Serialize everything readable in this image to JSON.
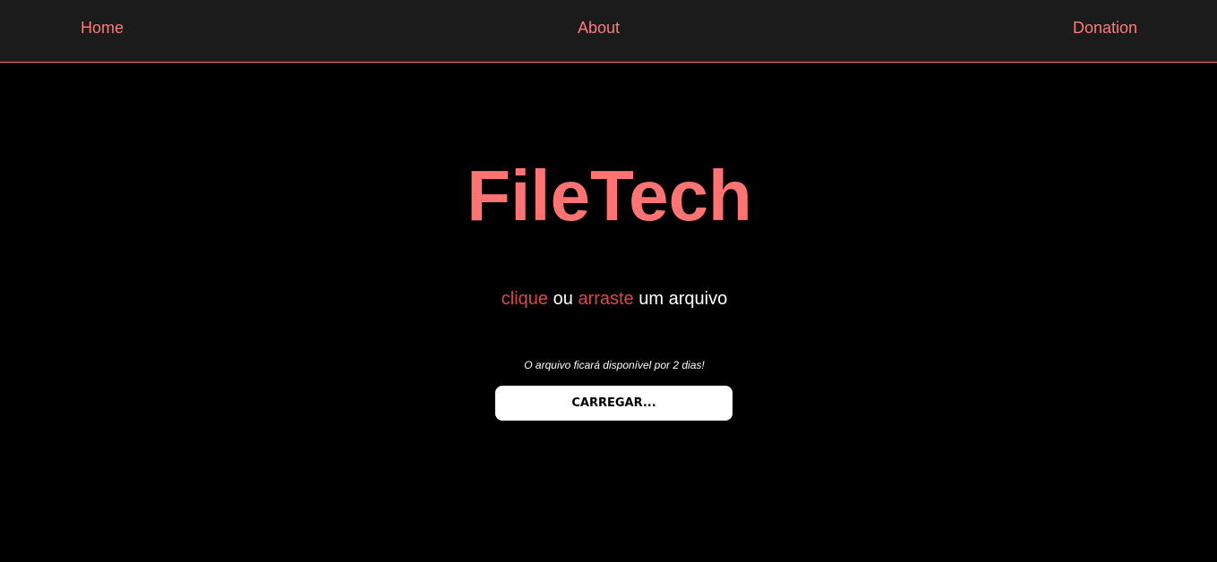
{
  "nav": {
    "home": "Home",
    "about": "About",
    "donation": "Donation"
  },
  "hero": {
    "title": "FileTech"
  },
  "dropzone": {
    "word_click": "clique",
    "word_or": "ou",
    "word_drag": "arraste",
    "word_rest": "um arquivo"
  },
  "note": "O arquivo ficará disponível por 2 dias!",
  "upload": {
    "label": "CARREGAR..."
  },
  "colors": {
    "accent": "#ff7373",
    "accent_dark": "#d94848",
    "navbar_bg": "#1b1b1b",
    "page_bg": "#000000"
  }
}
